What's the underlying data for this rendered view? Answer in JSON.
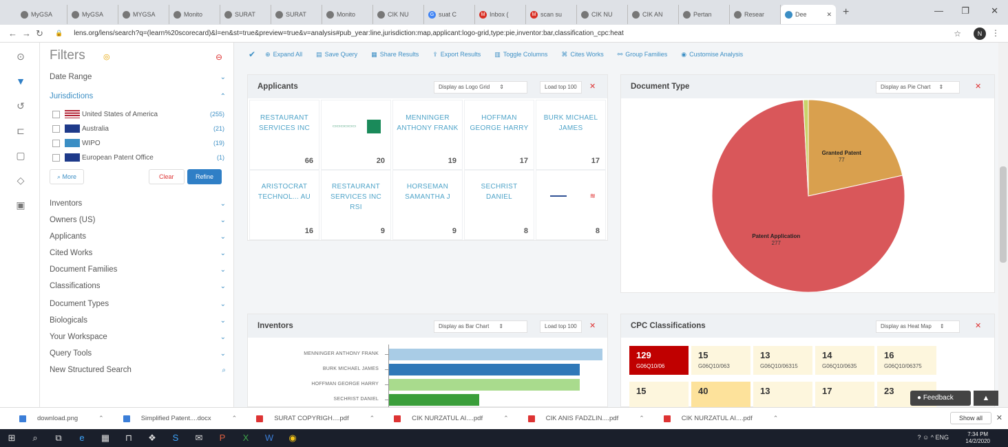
{
  "browser": {
    "tabs": [
      {
        "label": "MyGSA",
        "icon": "globe-icon"
      },
      {
        "label": "MyGSA",
        "icon": "globe-icon"
      },
      {
        "label": "MYGSA",
        "icon": "globe-icon"
      },
      {
        "label": "Monito",
        "icon": "globe-icon"
      },
      {
        "label": "SURAT",
        "icon": "globe-icon"
      },
      {
        "label": "SURAT",
        "icon": "globe-icon"
      },
      {
        "label": "Monito",
        "icon": "globe-icon"
      },
      {
        "label": "CIK NU",
        "icon": "globe-icon"
      },
      {
        "label": "suat C",
        "icon": "google-icon"
      },
      {
        "label": "Inbox (",
        "icon": "gmail-icon"
      },
      {
        "label": "scan su",
        "icon": "gmail-icon"
      },
      {
        "label": "CIK NU",
        "icon": "globe-icon"
      },
      {
        "label": "CIK AN",
        "icon": "globe-icon"
      },
      {
        "label": "Pertan",
        "icon": "globe-icon"
      },
      {
        "label": "Resear",
        "icon": "globe-icon"
      },
      {
        "label": "Dee",
        "icon": "lens-icon",
        "active": true
      }
    ],
    "url": "lens.org/lens/search?q=(learn%20scorecard)&l=en&st=true&preview=true&v=analysis#pub_year:line,jurisdiction:map,applicant:logo-grid,type:pie,inventor:bar,classification_cpc:heat",
    "profile_initial": "N"
  },
  "filters": {
    "title": "Filters",
    "items": [
      {
        "label": "Date Range"
      },
      {
        "label": "Jurisdictions",
        "expanded": true
      },
      {
        "label": "Inventors"
      },
      {
        "label": "Owners (US)"
      },
      {
        "label": "Applicants"
      },
      {
        "label": "Cited Works"
      },
      {
        "label": "Document Families"
      },
      {
        "label": "Classifications"
      },
      {
        "label": "Document Types"
      },
      {
        "label": "Biologicals"
      },
      {
        "label": "Your Workspace"
      },
      {
        "label": "Query Tools"
      },
      {
        "label": "New Structured Search"
      }
    ],
    "jurisdictions": [
      {
        "label": "United States of America",
        "count": "(255)",
        "flag": "us"
      },
      {
        "label": "Australia",
        "count": "(21)",
        "flag": "au"
      },
      {
        "label": "WIPO",
        "count": "(19)",
        "flag": "wipo"
      },
      {
        "label": "European Patent Office",
        "count": "(1)",
        "flag": "eu"
      }
    ],
    "more_label": "More",
    "clear_label": "Clear",
    "refine_label": "Refine"
  },
  "toolbar": {
    "items": [
      {
        "label": "Expand All"
      },
      {
        "label": "Save Query"
      },
      {
        "label": "Share Results"
      },
      {
        "label": "Export Results"
      },
      {
        "label": "Toggle Columns"
      },
      {
        "label": "Cites Works"
      },
      {
        "label": "Group Families"
      },
      {
        "label": "Customise Analysis"
      }
    ]
  },
  "applicants": {
    "title": "Applicants",
    "display": "Display as Logo Grid",
    "load": "Load top 100",
    "cells": [
      {
        "name": "RESTAURANT SERVICES INC",
        "count": "66"
      },
      {
        "name": "",
        "count": "20",
        "logo": "saudi-logo"
      },
      {
        "name": "MENNINGER ANTHONY FRANK",
        "count": "19"
      },
      {
        "name": "HOFFMAN GEORGE HARRY",
        "count": "17"
      },
      {
        "name": "BURK MICHAEL JAMES",
        "count": "17"
      },
      {
        "name": "ARISTOCRAT TECHNOL... AU",
        "count": "16"
      },
      {
        "name": "RESTAURANT SERVICES INC RSI",
        "count": "9"
      },
      {
        "name": "HORSEMAN SAMANTHA J",
        "count": "9"
      },
      {
        "name": "SECHRIST DANIEL",
        "count": "8"
      },
      {
        "name": "",
        "count": "8",
        "logo": "bank-of-america-logo"
      }
    ]
  },
  "document_type": {
    "title": "Document Type",
    "display": "Display as Pie Chart"
  },
  "inventors": {
    "title": "Inventors",
    "display": "Display as Bar Chart",
    "load": "Load top 100"
  },
  "cpc": {
    "title": "CPC Classifications",
    "display": "Display as Heat Map",
    "cells": [
      {
        "value": "129",
        "code": "G06Q10/06"
      },
      {
        "value": "15",
        "code": "G06Q10/063"
      },
      {
        "value": "13",
        "code": "G06Q10/06315"
      },
      {
        "value": "14",
        "code": "G06Q10/0635"
      },
      {
        "value": "16",
        "code": "G06Q10/06375"
      },
      {
        "value": "15",
        "code": ""
      },
      {
        "value": "40",
        "code": ""
      },
      {
        "value": "13",
        "code": ""
      },
      {
        "value": "17",
        "code": ""
      },
      {
        "value": "23",
        "code": ""
      }
    ]
  },
  "chart_data": [
    {
      "type": "pie",
      "slices": [
        {
          "label": "Granted Patent",
          "value": 77,
          "color": "#d9a04e"
        },
        {
          "label": "Patent Application",
          "value": 277,
          "color": "#d9575a"
        },
        {
          "label": "",
          "value": 3,
          "color": "#c9d36a"
        }
      ]
    },
    {
      "type": "bar",
      "orientation": "horizontal",
      "categories": [
        "MENNINGER ANTHONY FRANK",
        "BURK MICHAEL JAMES",
        "HOFFMAN GEORGE HARRY",
        "SECHRIST DANIEL"
      ],
      "values": [
        19,
        17,
        17,
        8
      ],
      "colors": [
        "#a9cce6",
        "#2f78b8",
        "#a9db8d",
        "#3a9e3a"
      ]
    }
  ],
  "feedback_label": "Feedback",
  "downloads": {
    "items": [
      {
        "label": "download.png"
      },
      {
        "label": "Simplified Patent....docx"
      },
      {
        "label": "SURAT COPYRIGH....pdf"
      },
      {
        "label": "CIK NURZATUL AI....pdf"
      },
      {
        "label": "CIK ANIS FADZLIN....pdf"
      },
      {
        "label": "CIK NURZATUL AI....pdf"
      }
    ],
    "show_all": "Show all"
  },
  "taskbar": {
    "language": "ENG",
    "time": "7:34 PM",
    "date": "14/2/2020"
  }
}
